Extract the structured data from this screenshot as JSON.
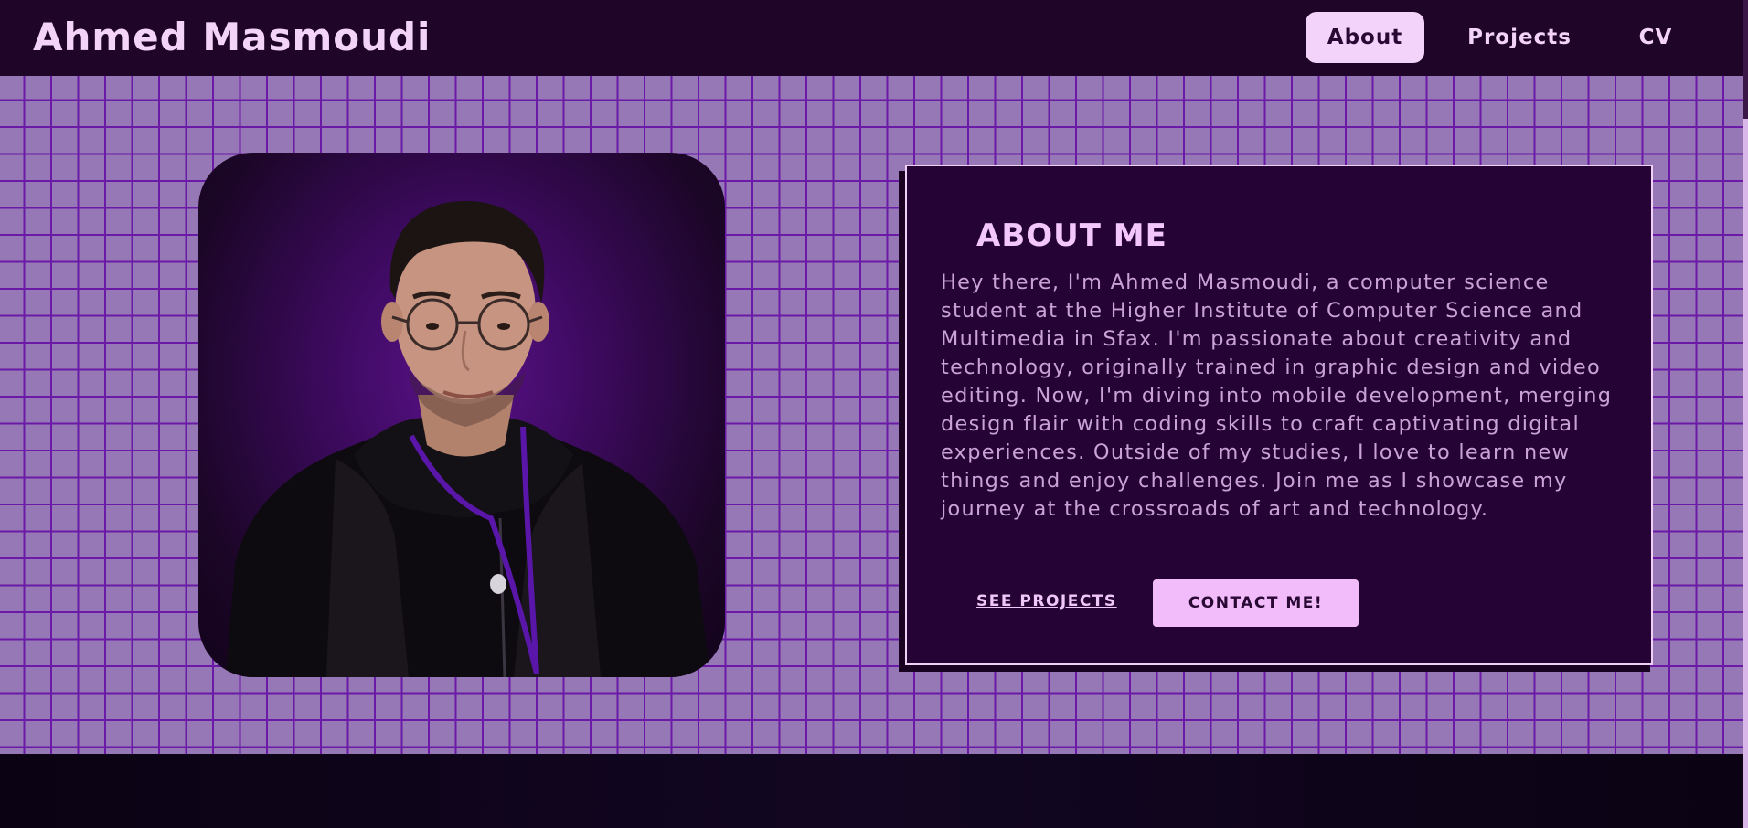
{
  "navbar": {
    "brand": "Ahmed Masmoudi",
    "links": [
      {
        "label": "About",
        "active": true
      },
      {
        "label": "Projects",
        "active": false
      },
      {
        "label": "CV",
        "active": false
      }
    ]
  },
  "about": {
    "title": "ABOUT ME",
    "body": "Hey there, I'm Ahmed Masmoudi, a computer science student at the Higher Institute of Computer Science and Multimedia in Sfax. I'm passionate about creativity and technology, originally trained in graphic design and video editing. Now, I'm diving into mobile development, merging design flair with coding skills to craft captivating digital experiences. Outside of my studies, I love to learn new things and enjoy challenges. Join me as I showcase my journey at the crossroads of art and technology.",
    "see_projects_label": "SEE PROJECTS",
    "contact_label": "CONTACT ME!"
  },
  "colors": {
    "nav_bg": "#1f0527",
    "accent": "#f4d3fa",
    "grid_bg": "#9678b6",
    "grid_line": "#6a1aa6",
    "card_bg": "#260335"
  }
}
